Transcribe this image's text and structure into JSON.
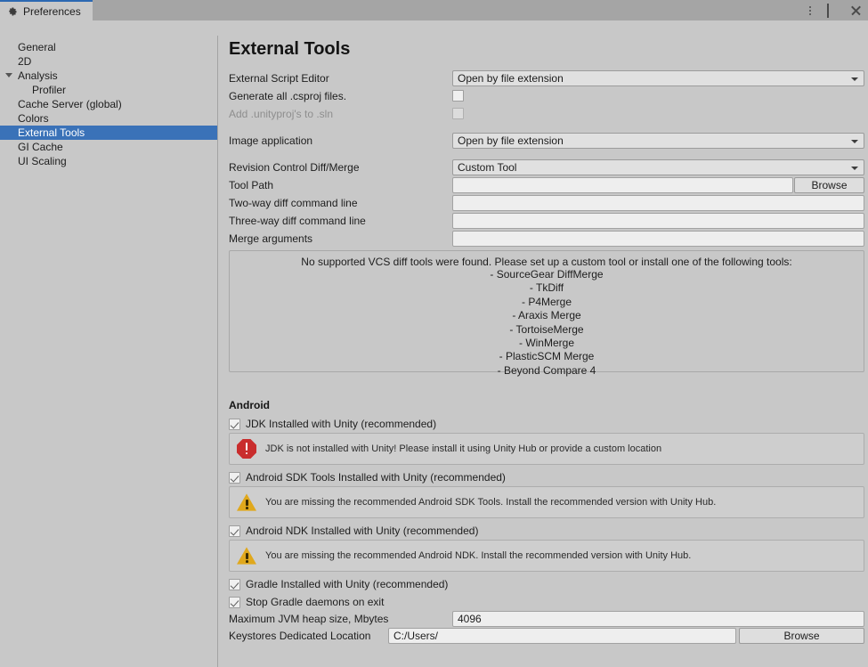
{
  "window": {
    "tab_label": "Preferences",
    "tab_icon": "gear-icon",
    "menu_icon": "more-vertical-icon",
    "maximize_icon": "maximize-icon",
    "close_icon": "close-icon"
  },
  "search": {
    "value": "",
    "placeholder": "",
    "icon": "search-icon"
  },
  "sidebar": {
    "items": [
      {
        "label": "General",
        "indent": 0,
        "selected": false,
        "expandable": false
      },
      {
        "label": "2D",
        "indent": 0,
        "selected": false,
        "expandable": false
      },
      {
        "label": "Analysis",
        "indent": 0,
        "selected": false,
        "expandable": true
      },
      {
        "label": "Profiler",
        "indent": 1,
        "selected": false,
        "expandable": false
      },
      {
        "label": "Cache Server (global)",
        "indent": 0,
        "selected": false,
        "expandable": false
      },
      {
        "label": "Colors",
        "indent": 0,
        "selected": false,
        "expandable": false
      },
      {
        "label": "External Tools",
        "indent": 0,
        "selected": true,
        "expandable": false
      },
      {
        "label": "GI Cache",
        "indent": 0,
        "selected": false,
        "expandable": false
      },
      {
        "label": "UI Scaling",
        "indent": 0,
        "selected": false,
        "expandable": false
      }
    ]
  },
  "main": {
    "title": "External Tools",
    "external_script_editor": {
      "label": "External Script Editor",
      "value": "Open by file extension"
    },
    "generate_csproj": {
      "label": "Generate all .csproj files.",
      "checked": false,
      "disabled": false
    },
    "add_unityproj": {
      "label": "Add .unityproj's to .sln",
      "checked": false,
      "disabled": true
    },
    "image_application": {
      "label": "Image application",
      "value": "Open by file extension"
    },
    "revision_control": {
      "label": "Revision Control Diff/Merge",
      "value": "Custom Tool"
    },
    "tool_path": {
      "label": "Tool Path",
      "value": "",
      "browse_label": "Browse"
    },
    "two_way_diff": {
      "label": "Two-way diff command line",
      "value": ""
    },
    "three_way_diff": {
      "label": "Three-way diff command line",
      "value": ""
    },
    "merge_arguments": {
      "label": "Merge arguments",
      "value": ""
    },
    "vcs_info": {
      "headline": "No supported VCS diff tools were found. Please set up a custom tool or install one of the following tools:",
      "tools": [
        "- SourceGear DiffMerge",
        "- TkDiff",
        "- P4Merge",
        "- Araxis Merge",
        "- TortoiseMerge",
        "- WinMerge",
        "- PlasticSCM Merge",
        "- Beyond Compare 4"
      ]
    },
    "android": {
      "section_label": "Android",
      "jdk": {
        "label": "JDK Installed with Unity (recommended)",
        "checked": true,
        "message": "JDK is not installed with Unity! Please install it using Unity Hub or provide a custom location",
        "message_type": "error",
        "message_icon": "error-icon"
      },
      "sdk": {
        "label": "Android SDK Tools Installed with Unity (recommended)",
        "checked": true,
        "message": "You are missing the recommended Android SDK Tools. Install the recommended version with Unity Hub.",
        "message_type": "warning",
        "message_icon": "warning-icon"
      },
      "ndk": {
        "label": "Android NDK Installed with Unity (recommended)",
        "checked": true,
        "message": "You are missing the recommended Android NDK. Install the recommended version with Unity Hub.",
        "message_type": "warning",
        "message_icon": "warning-icon"
      },
      "gradle": {
        "label": "Gradle Installed with Unity (recommended)",
        "checked": true
      },
      "stop_gradle": {
        "label": "Stop Gradle daemons on exit",
        "checked": true
      },
      "jvm_heap": {
        "label": "Maximum JVM heap size, Mbytes",
        "value": "4096"
      },
      "keystores": {
        "label": "Keystores Dedicated Location",
        "value": "C:/Users/",
        "browse_label": "Browse"
      }
    }
  },
  "colors": {
    "selection_blue": "#3a72b8",
    "tab_accent": "#2c68b2",
    "error_red": "#c92d2d",
    "warning_amber": "#e0a81c",
    "panel_bg": "#c8c8c8"
  }
}
